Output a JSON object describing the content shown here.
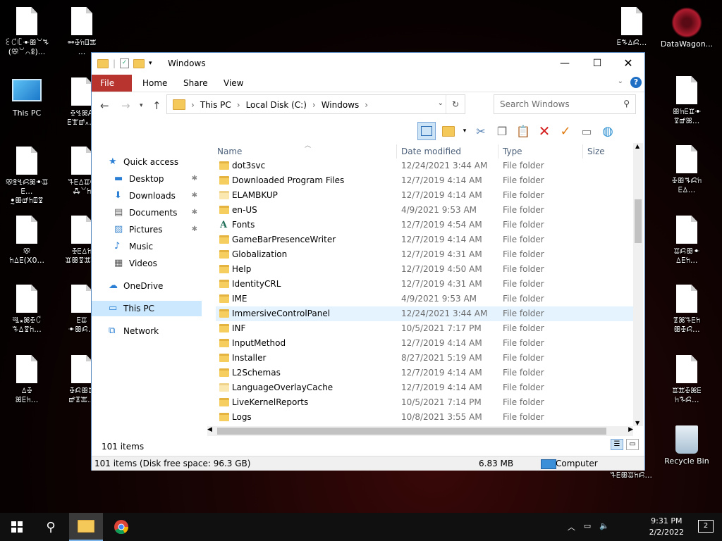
{
  "desktop": {
    "icons_left": [
      {
        "label": "ꏂ꒝ꏸꔹꕥ꒡ꘔ\n(ꕣ꒡꒢ꖵ)..."
      },
      {
        "label": "ꗮꔀꖷꘖꕭ\n..."
      },
      {
        "label": "This PC"
      },
      {
        "label": "ꔀꔈꕤꓮ\nꗋꖁꕡ꘍..."
      },
      {
        "label": "ꕣꖵꔈꗲꕤꔹꘑꗋ...\nꔸꕥꕡꖷꘖꗒ"
      },
      {
        "label": "ꘔꗋꕔꘑꔮ\nꗈ꒡ꖷ"
      },
      {
        "label": "ꕣ\nꖷꕔꗋ(X0..."
      },
      {
        "label": "ꔀꗋꕔꖷ\nꘑꕥꗒꕭ..."
      },
      {
        "label": "ꗆ꘎ꕤꔀ꒝\nꘔꕔꗒꖷ..."
      },
      {
        "label": "ꗋꘑ\nꔹꕥꗲ..."
      },
      {
        "label": "ꕔꔀ\nꕤꗋꖷ..."
      },
      {
        "label": "ꔀꗲꕥꘑ\nꕡꗒꕭ..."
      }
    ],
    "icons_right": [
      {
        "label": "ꗋꘔꕔꗲ..."
      },
      {
        "label": "DataWagon..."
      },
      {
        "label": "ꕥꖷꗋꘑꔹ\nꗒꕡꕤ..."
      },
      {
        "label": "ꔀꕥꘔꗲꖷ\nꗋꕔ..."
      },
      {
        "label": "ꘑꗲꕥꔹ\nꕔꗋꖷ..."
      },
      {
        "label": "ꗒꕤꘔꗋꖷ\nꕥꔀꗲ..."
      },
      {
        "label": "ꘑꕭꔀꕤꗋ\nꖷꘔꗲ..."
      },
      {
        "label": "Recycle Bin"
      }
    ],
    "overlay_text": "ꘔꗋꕥꘑꖷꗲ..."
  },
  "window": {
    "title": "Windows",
    "ribbon_tabs": [
      "File",
      "Home",
      "Share",
      "View"
    ],
    "breadcrumbs": [
      "This PC",
      "Local Disk (C:)",
      "Windows"
    ],
    "search_placeholder": "Search Windows",
    "columns": [
      "Name",
      "Date modified",
      "Type",
      "Size"
    ],
    "nav": [
      {
        "label": "Quick access",
        "icon": "star-icon"
      },
      {
        "label": "Desktop",
        "icon": "desktop-icon",
        "pinned": true
      },
      {
        "label": "Downloads",
        "icon": "download-icon",
        "pinned": true
      },
      {
        "label": "Documents",
        "icon": "document-icon",
        "pinned": true
      },
      {
        "label": "Pictures",
        "icon": "picture-icon",
        "pinned": true
      },
      {
        "label": "Music",
        "icon": "music-icon"
      },
      {
        "label": "Videos",
        "icon": "video-icon"
      },
      {
        "label": "OneDrive",
        "icon": "cloud-icon"
      },
      {
        "label": "This PC",
        "icon": "computer-icon",
        "selected": true
      },
      {
        "label": "Network",
        "icon": "network-icon"
      }
    ],
    "files": [
      {
        "name": "dot3svc",
        "date": "12/24/2021 3:44 AM",
        "type": "File folder"
      },
      {
        "name": "Downloaded Program Files",
        "date": "12/7/2019 4:14 AM",
        "type": "File folder"
      },
      {
        "name": "ELAMBKUP",
        "date": "12/7/2019 4:14 AM",
        "type": "File folder"
      },
      {
        "name": "en-US",
        "date": "4/9/2021 9:53 AM",
        "type": "File folder"
      },
      {
        "name": "Fonts",
        "date": "12/7/2019 4:54 AM",
        "type": "File folder"
      },
      {
        "name": "GameBarPresenceWriter",
        "date": "12/7/2019 4:14 AM",
        "type": "File folder"
      },
      {
        "name": "Globalization",
        "date": "12/7/2019 4:31 AM",
        "type": "File folder"
      },
      {
        "name": "Help",
        "date": "12/7/2019 4:50 AM",
        "type": "File folder"
      },
      {
        "name": "IdentityCRL",
        "date": "12/7/2019 4:31 AM",
        "type": "File folder"
      },
      {
        "name": "IME",
        "date": "4/9/2021 9:53 AM",
        "type": "File folder"
      },
      {
        "name": "ImmersiveControlPanel",
        "date": "12/24/2021 3:44 AM",
        "type": "File folder"
      },
      {
        "name": "INF",
        "date": "10/5/2021 7:17 PM",
        "type": "File folder"
      },
      {
        "name": "InputMethod",
        "date": "12/7/2019 4:14 AM",
        "type": "File folder"
      },
      {
        "name": "Installer",
        "date": "8/27/2021 5:19 AM",
        "type": "File folder"
      },
      {
        "name": "L2Schemas",
        "date": "12/7/2019 4:14 AM",
        "type": "File folder"
      },
      {
        "name": "LanguageOverlayCache",
        "date": "12/7/2019 4:14 AM",
        "type": "File folder"
      },
      {
        "name": "LiveKernelReports",
        "date": "10/5/2021 7:14 PM",
        "type": "File folder"
      },
      {
        "name": "Logs",
        "date": "10/8/2021 3:55 AM",
        "type": "File folder"
      }
    ],
    "item_count": "101 items",
    "status_left": "101 items (Disk free space: 96.3 GB)",
    "status_size": "6.83 MB",
    "status_location": "Computer"
  },
  "taskbar": {
    "time": "9:31 PM",
    "date": "2/2/2022",
    "notifications": "2"
  },
  "colors": {
    "file_tab": "#b8342e",
    "selection": "#e5f3ff",
    "folder": "#f6cd5f"
  }
}
